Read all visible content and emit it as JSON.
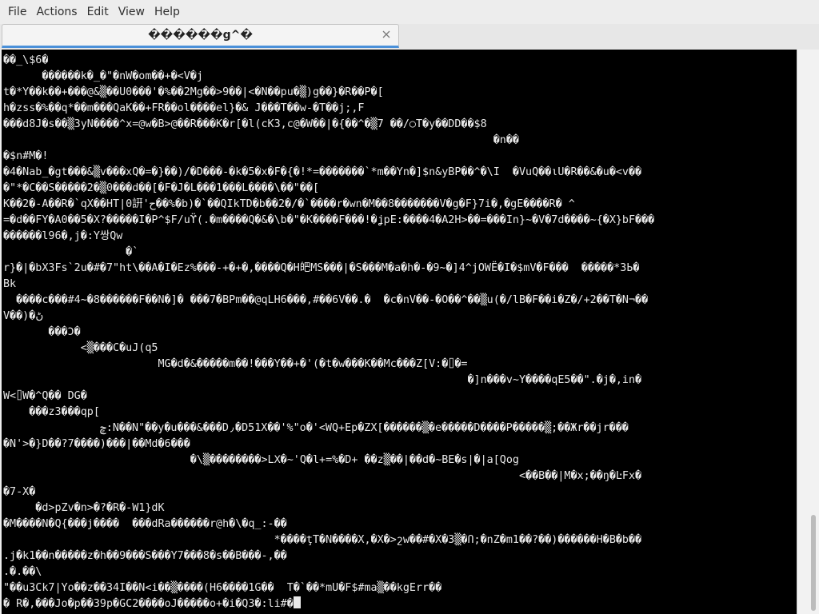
{
  "menubar": {
    "items": [
      "File",
      "Actions",
      "Edit",
      "View",
      "Help"
    ]
  },
  "tab": {
    "title": "������g^�",
    "close_icon": "close-icon"
  },
  "terminal": {
    "lines": [
      "��_\\$6�",
      "      ������k�_�\"�nW�om��+�<V�j",
      "t�*Y��k��+���@&▒��U0���'�%��2Mg��>9��|<�N��pu�▒)g��}�R��P�[",
      "h�zss�%��q*��m���QaK��+FR��ol����el}�& J���T��w-�T��j;,F",
      "���d8J�s��▒3yN����^x=@w�B>@��R���K�r[�l(cK3,c@�W��|�{��^�▒7 ��/○T�y��DD��$8",
      "                                                                            �n��",
      "�$n#M�!",
      "�4�Nab_�gt���&▒v���xQ�=�}��)/�D���-�k�5�x�F�{�!*=�������`*m��Yn�]$n&yBP��^�\\I  �VuQ��ιU�R��&�u�<v��",
      "�\"*�C��S�����2�▒0���d��[�F�J�L���1���L����\\��\"��[",
      "K��2�-A��R�`qX��HT|0詽'ح��%�b)�`��QIkTD�b��2�/�`����r�wn�M��8�������V�g�F}7i�,�gE����R� ^",
      "=�d��FY�A0��5�X?�����I�P^$F/uϔ(.�m����Q�&�\\b�\"�K����F���!�ʝpE:����4�A2H>��=���In}~�V�7d����~{�X}bF���",
      "������l96�,j�:Y쌍Qw",
      "                   �`",
      "r}�|�bX3Fs`2u�#�7\"ht\\��A�I�Ez%���-+�+�,����Q�H皅MS���|�S���M�a�h�-�9~�]4^jOWË�I�$mV�F���  �����*3Ь�",
      "Bk",
      "  ����c���#4~�8������F��N�]� ���7�BPm��@qLH6���,#��6V��.�  �c�nV��-�O��^��▒u(�/lB�F��i�Z�/+2��T�N¬��",
      "V��)�ڻ",
      "       ���Ͻ�",
      "            <▒���C�uJ(q5",
      "                        MG�d�&�����m��!���Y��+�'(�t�w���K��Mc���Z[V:�⌷�=",
      "                                                                        �]n���v~Y����qE5��\".�j�,in�",
      "W<⌷W�^Q�� DG�",
      "    ���z3���qp[",
      "               ݼ:N��N\"��y�u���&���D٫�D51X��'%\"o�'<WQ+Ep�ZX[������▒�e�����D����P�����▒;��Жr��jr���",
      "�N'>�}D��?7����)���|��Md�6���",
      "                             �\\▒��������>LΧ�~'Q�l+=%�D+ ��z▒��|��d�~BE�s|�|a[Qog",
      "                                                                                <��B��|M�x;��ŋ�ĿFx�",
      "�7-X�",
      "     �d>pZv�n>�?�R�-W1}dK",
      "�M����N�Q{���j����  ���dRa������r@h�\\�q_:-��",
      "                                          *����ţT�N����X,�X�>շw��#�X�3▒�Ո;�nZ�m1��?��)������H�B�b��",
      ".j�k1��n�����z�h��9���S���Y7���8�s��B���-,��",
      ".�.��\\",
      "\"��u3Ck7|Yo��z��34I��N<i��▒����(H6����1G��  T�`��*mU�F$#ma▒��kgErr��",
      "� R�,���Jo�p��39p�GC2����oJ�����o+�i�Q3�:li#�"
    ]
  }
}
